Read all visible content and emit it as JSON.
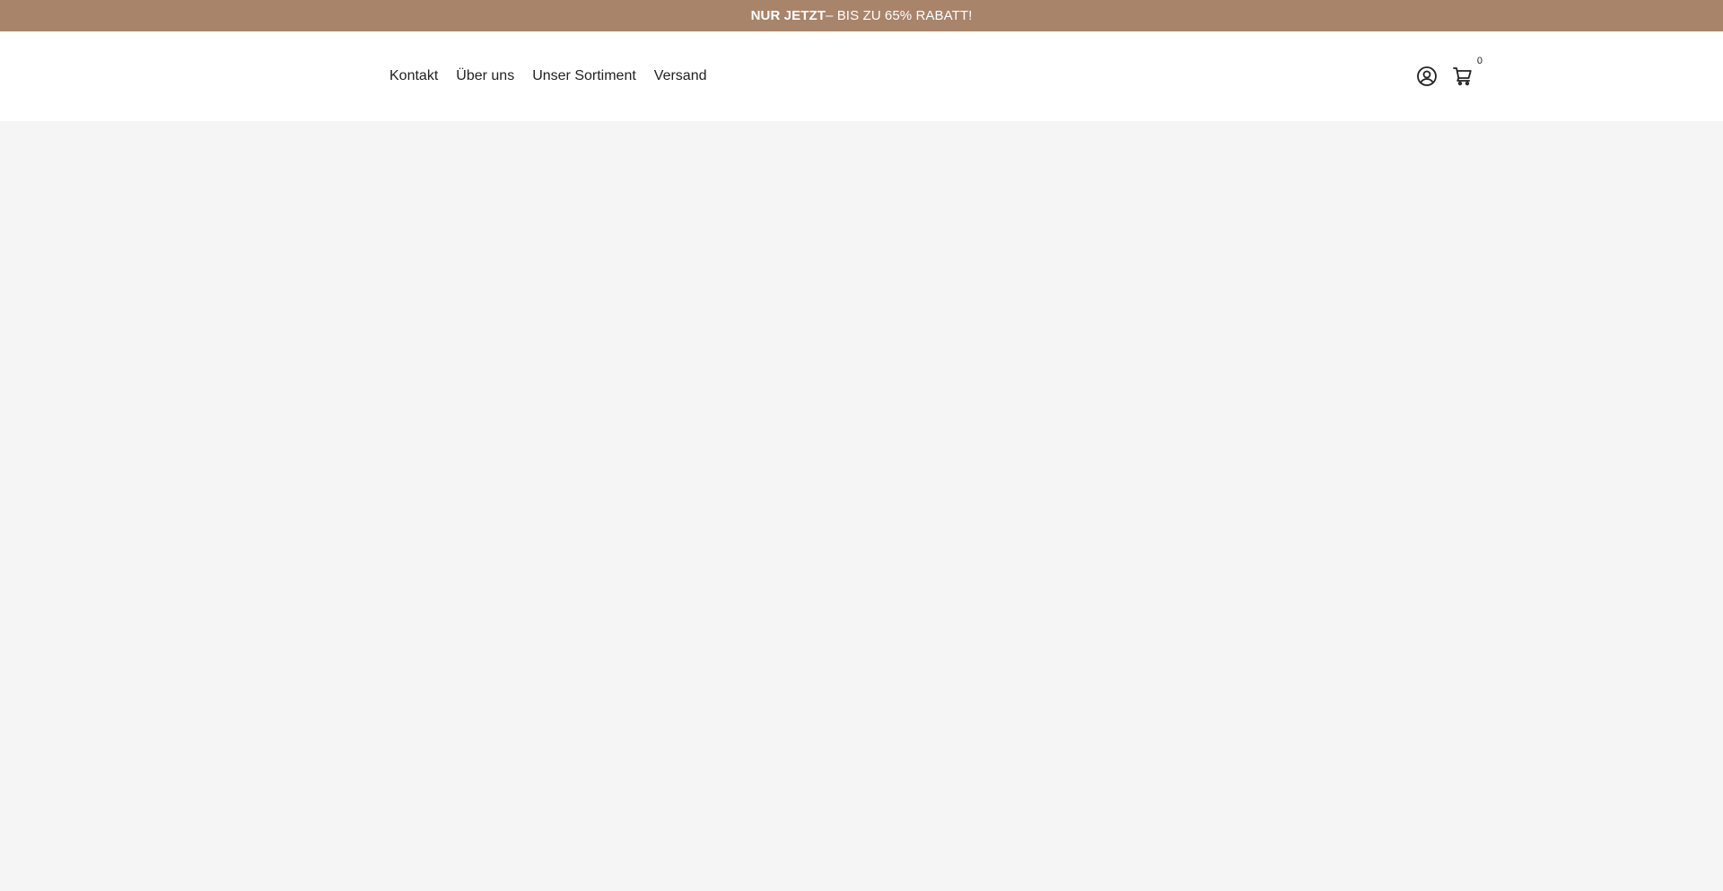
{
  "announcement": {
    "bold_text": "NUR JETZT",
    "rest_text": " – BIS ZU 65% RABATT!"
  },
  "nav": {
    "items": [
      {
        "label": "Kontakt"
      },
      {
        "label": "Über uns"
      },
      {
        "label": "Unser Sortiment"
      },
      {
        "label": "Versand"
      }
    ]
  },
  "header_icons": {
    "account_icon": "user-circle-icon",
    "cart_icon": "shopping-cart-icon",
    "cart_count": "0"
  },
  "colors": {
    "announcement_bg": "#a8846a",
    "announcement_text": "#ffffff",
    "header_bg": "#ffffff",
    "page_bg": "#f5f5f5",
    "text": "#222222"
  }
}
